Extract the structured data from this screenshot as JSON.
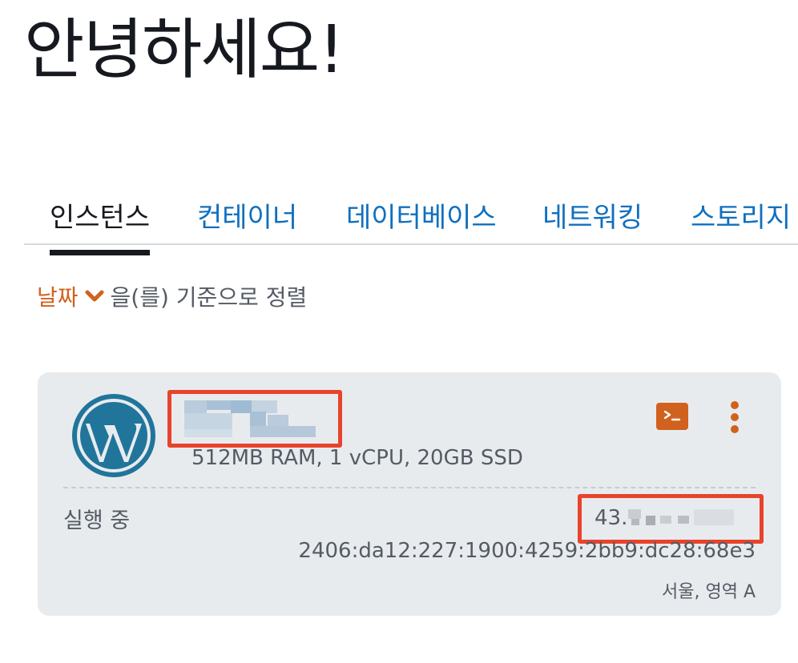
{
  "header": {
    "greeting": "안녕하세요!"
  },
  "tabs": [
    {
      "label": "인스턴스",
      "active": true
    },
    {
      "label": "컨테이너",
      "active": false
    },
    {
      "label": "데이터베이스",
      "active": false
    },
    {
      "label": "네트워킹",
      "active": false
    },
    {
      "label": "스토리지",
      "active": false
    }
  ],
  "sort": {
    "field": "날짜",
    "suffix": "을(를) 기준으로 정렬",
    "icon": "chevron-down-icon"
  },
  "instance": {
    "icon": "wordpress-logo",
    "specs": "512MB RAM, 1 vCPU, 20GB SSD",
    "status": "실행 중",
    "ipv4_prefix": "43.",
    "ipv6": "2406:da12:227:1900:4259:2bb9:dc28:68e3",
    "region": "서울, 영역 A"
  },
  "colors": {
    "accent": "#d0621d",
    "link": "#0f6fbf",
    "card_bg": "#e8ebee",
    "redaction_border": "#e8432b",
    "wordpress_blue": "#21759b"
  }
}
